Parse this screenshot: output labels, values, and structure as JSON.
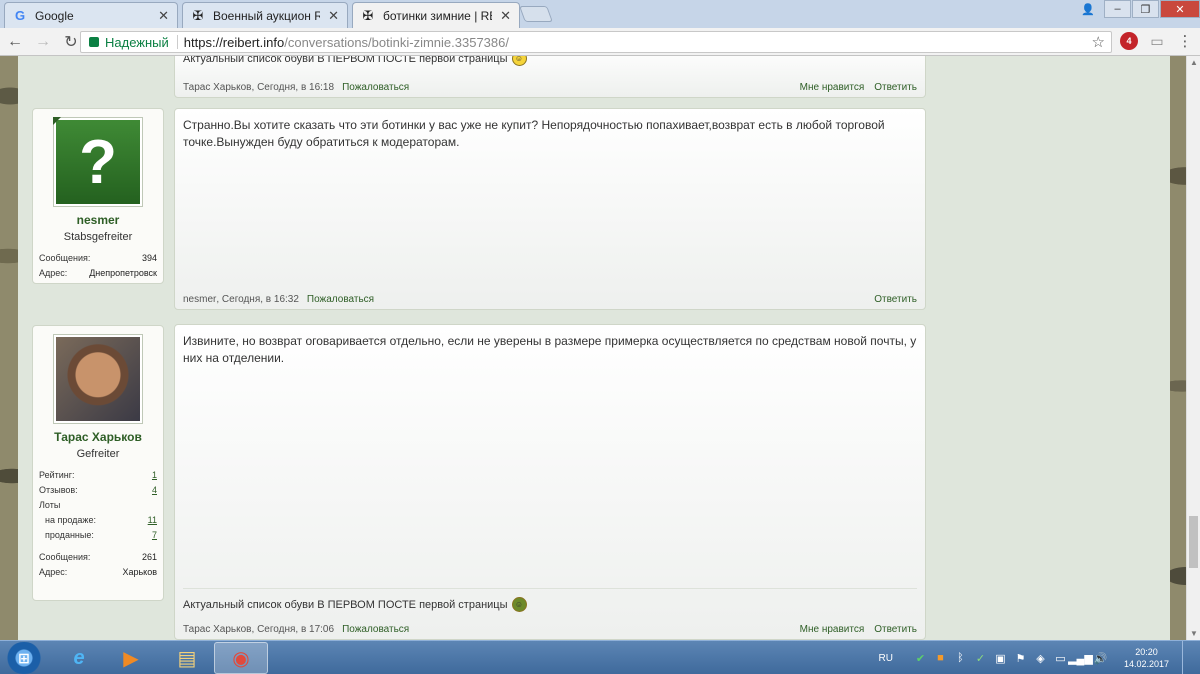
{
  "browser": {
    "tabs": [
      {
        "title": "Google",
        "icon": "google-icon"
      },
      {
        "title": "Военный аукцион REIBE",
        "icon": "iron-cross-icon"
      },
      {
        "title": "ботинки зимние | REIBE",
        "icon": "iron-cross-icon"
      }
    ],
    "secure_label": "Надежный",
    "url_host": "https://reibert.info",
    "url_path": "/conversations/botinki-zimnie.3357386/",
    "abp_badge": "4"
  },
  "posts": [
    {
      "signature": "Актуальный список обуви В ПЕРВОМ ПОСТЕ первой страницы",
      "author": "Тарас Харьков",
      "time": "Сегодня, в 16:18",
      "report": "Пожаловаться",
      "like": "Мне нравится",
      "reply": "Ответить"
    },
    {
      "text": "Странно.Вы хотите сказать что эти ботинки у вас уже не купит? Непорядочностью попахивает,возврат есть в любой торговой точке.Вынужден буду обратиться к модераторам.",
      "author": "nesmer",
      "time": "Сегодня, в 16:32",
      "report": "Пожаловаться",
      "reply": "Ответить",
      "user": {
        "name": "nesmer",
        "rank": "Stabsgefreiter",
        "messages_label": "Сообщения:",
        "messages": "394",
        "address_label": "Адрес:",
        "address": "Днепропетровск"
      }
    },
    {
      "text": "Извините, но возврат оговаривается отдельно, если не уверены в размере примерка осуществляется по средствам новой почты, у них на отделении.",
      "signature": "Актуальный список обуви В ПЕРВОМ ПОСТЕ первой страницы",
      "author": "Тарас Харьков",
      "time": "Сегодня, в 17:06",
      "report": "Пожаловаться",
      "like": "Мне нравится",
      "reply": "Ответить",
      "user": {
        "name": "Тарас Харьков",
        "rank": "Gefreiter",
        "rating_label": "Рейтинг:",
        "rating": "1",
        "reviews_label": "Отзывов:",
        "reviews": "4",
        "lots_label": "Лоты",
        "for_sale_label": "на продаже:",
        "for_sale": "11",
        "sold_label": "проданные:",
        "sold": "7",
        "messages_label": "Сообщения:",
        "messages": "261",
        "address_label": "Адрес:",
        "address": "Харьков"
      }
    }
  ],
  "taskbar": {
    "lang": "RU",
    "time": "20:20",
    "date": "14.02.2017"
  }
}
